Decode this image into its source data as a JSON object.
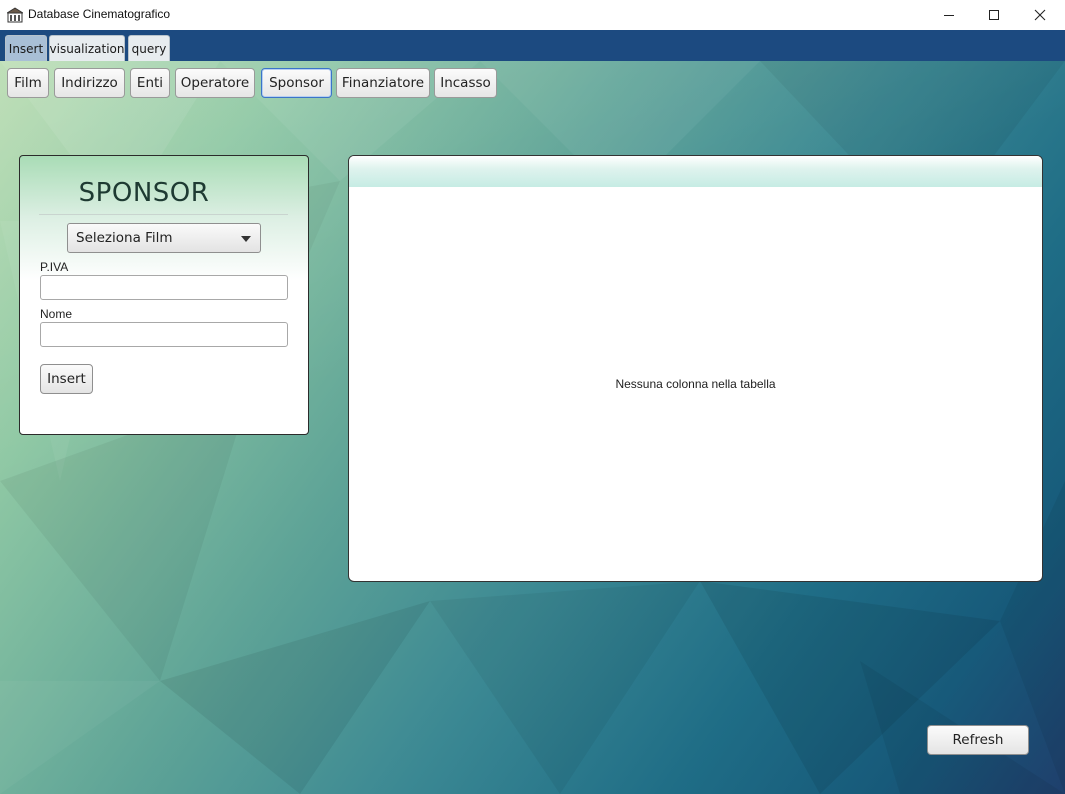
{
  "window": {
    "title": "Database Cinematografico",
    "icon": "building-icon",
    "controls": [
      "minimize-icon",
      "maximize-icon",
      "close-icon"
    ]
  },
  "main_tabs": [
    {
      "label": "Insert",
      "selected": true
    },
    {
      "label": "visualization",
      "selected": false
    },
    {
      "label": "query",
      "selected": false
    }
  ],
  "sub_tabs": [
    {
      "label": "Film",
      "active": false
    },
    {
      "label": "Indirizzo",
      "active": false
    },
    {
      "label": "Enti",
      "active": false
    },
    {
      "label": "Operatore",
      "active": false
    },
    {
      "label": "Sponsor",
      "active": true
    },
    {
      "label": "Finanziatore",
      "active": false
    },
    {
      "label": "Incasso",
      "active": false
    }
  ],
  "form": {
    "title": "SPONSOR",
    "film_select": {
      "value": "Seleziona Film",
      "icon": "chevron-down-icon"
    },
    "piva": {
      "label": "P.IVA",
      "value": "",
      "placeholder": ""
    },
    "nome": {
      "label": "Nome",
      "value": "",
      "placeholder": ""
    },
    "insert_label": "Insert"
  },
  "table": {
    "placeholder": "Nessuna colonna nella tabella"
  },
  "refresh_label": "Refresh",
  "colors": {
    "tab_strip": "#1c4a80",
    "active_border": "#3b74c9",
    "panel_header": "#a9dcb6"
  }
}
